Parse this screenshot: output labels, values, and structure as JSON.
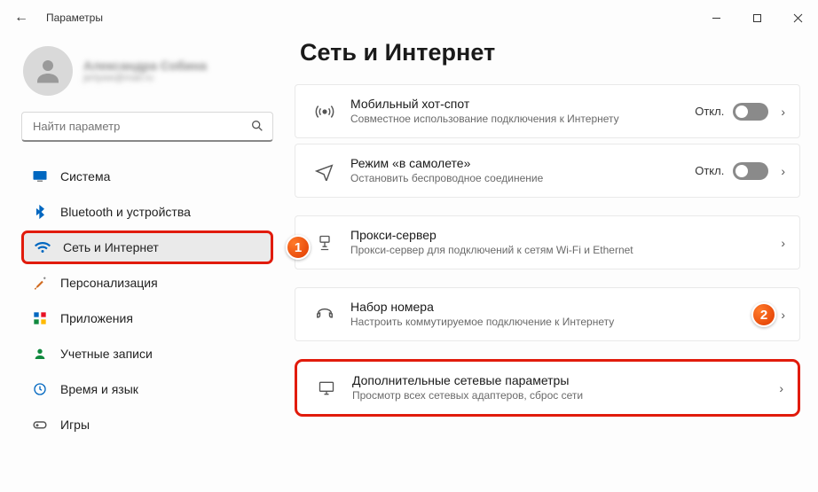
{
  "window": {
    "title": "Параметры"
  },
  "user": {
    "name": "Александра Собина",
    "email": "jertywe@mail.ru"
  },
  "search": {
    "placeholder": "Найти параметр"
  },
  "sidebar": {
    "items": [
      {
        "label": "Система"
      },
      {
        "label": "Bluetooth и устройства"
      },
      {
        "label": "Сеть и Интернет"
      },
      {
        "label": "Персонализация"
      },
      {
        "label": "Приложения"
      },
      {
        "label": "Учетные записи"
      },
      {
        "label": "Время и язык"
      },
      {
        "label": "Игры"
      }
    ]
  },
  "page": {
    "title": "Сеть и Интернет"
  },
  "cards": {
    "hotspot": {
      "title": "Мобильный хот-спот",
      "desc": "Совместное использование подключения к Интернету",
      "status": "Откл."
    },
    "airplane": {
      "title": "Режим «в самолете»",
      "desc": "Остановить беспроводное соединение",
      "status": "Откл."
    },
    "proxy": {
      "title": "Прокси-сервер",
      "desc": "Прокси-сервер для подключений к сетям Wi-Fi и Ethernet"
    },
    "dialup": {
      "title": "Набор номера",
      "desc": "Настроить коммутируемое подключение к Интернету"
    },
    "advanced": {
      "title": "Дополнительные сетевые параметры",
      "desc": "Просмотр всех сетевых адаптеров, сброс сети"
    }
  },
  "annotations": {
    "one": "1",
    "two": "2"
  }
}
